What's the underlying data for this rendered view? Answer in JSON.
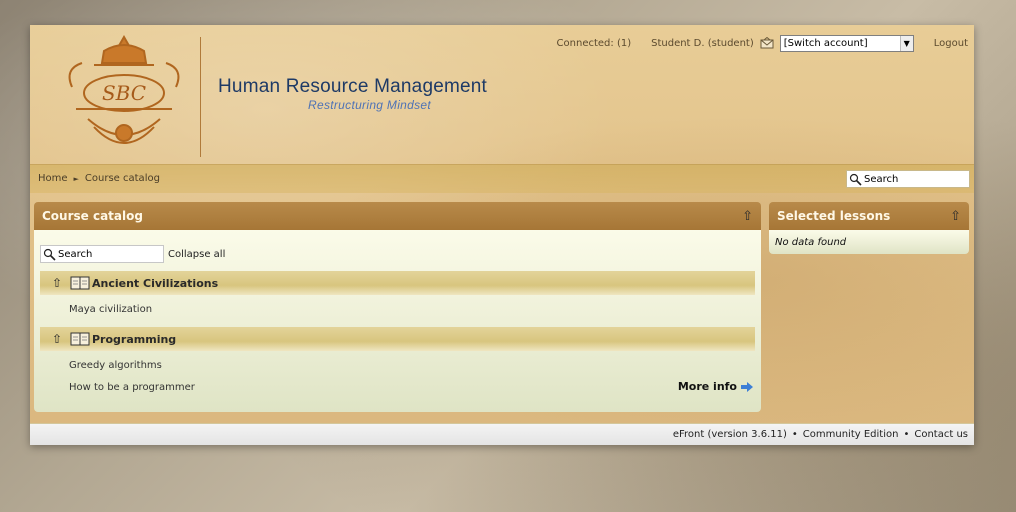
{
  "brand": {
    "logo_text": "SBC",
    "title": "Human Resource Management",
    "subtitle": "Restructuring Mindset"
  },
  "topbar": {
    "connected": "Connected: (1)",
    "user": "Student D. (student)",
    "switch_account": "[Switch account]",
    "logout": "Logout"
  },
  "breadcrumb": {
    "home": "Home",
    "current": "Course catalog"
  },
  "nav_search_placeholder": "Search",
  "catalog": {
    "title": "Course catalog",
    "search_placeholder": "Search",
    "collapse_all": "Collapse all",
    "categories": [
      {
        "name": "Ancient Civilizations",
        "lessons": [
          "Maya civilization"
        ]
      },
      {
        "name": "Programming",
        "lessons": [
          "Greedy algorithms",
          "How to be a programmer"
        ]
      }
    ],
    "more_info": "More info"
  },
  "selected_lessons": {
    "title": "Selected lessons",
    "empty": "No data found"
  },
  "footer": {
    "version": "eFront (version 3.6.11)",
    "edition": "Community Edition",
    "contact": "Contact us",
    "separator": "•"
  },
  "colors": {
    "panel_header": "#a67636",
    "brand_title": "#1e3a66",
    "brand_subtitle": "#4f73b5"
  }
}
